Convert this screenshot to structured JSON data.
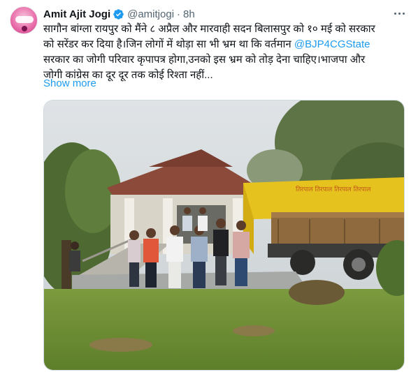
{
  "tweet": {
    "author_name": "Amit Ajit Jogi",
    "handle": "@amitjogi",
    "separator": "·",
    "time": "8h",
    "text_lines": [
      "सागौन बांग्ला रायपुर को  मैंने ८ अप्रैल और मारवाही सदन बिलासपुर को १० मई को सरकार",
      "को सरेंडर कर दिया है।जिन लोगों में थोड़ा सा भी भ्रम था कि वर्तमान ",
      "सरकार का जोगी परिवार कृपापत्र होगा,उनको इस भ्रम को तोड़ देना चाहिए।भाजपा और",
      "जोगी कांग्रेस का दूर दूर तक कोई रिश्ता नहीं..."
    ],
    "mention": "@BJP4CGState",
    "show_more_label": "Show more",
    "truck_banner_text": "तिरपाल तिरपाल तिरपाल तिरपाल"
  },
  "icons": {
    "verified": "verified-badge-icon",
    "more": "more-options-icon"
  },
  "colors": {
    "link": "#1d9bf0",
    "verified": "#1d9bf0",
    "secondary_text": "#536471",
    "truck_tarp": "#e6c21f"
  }
}
